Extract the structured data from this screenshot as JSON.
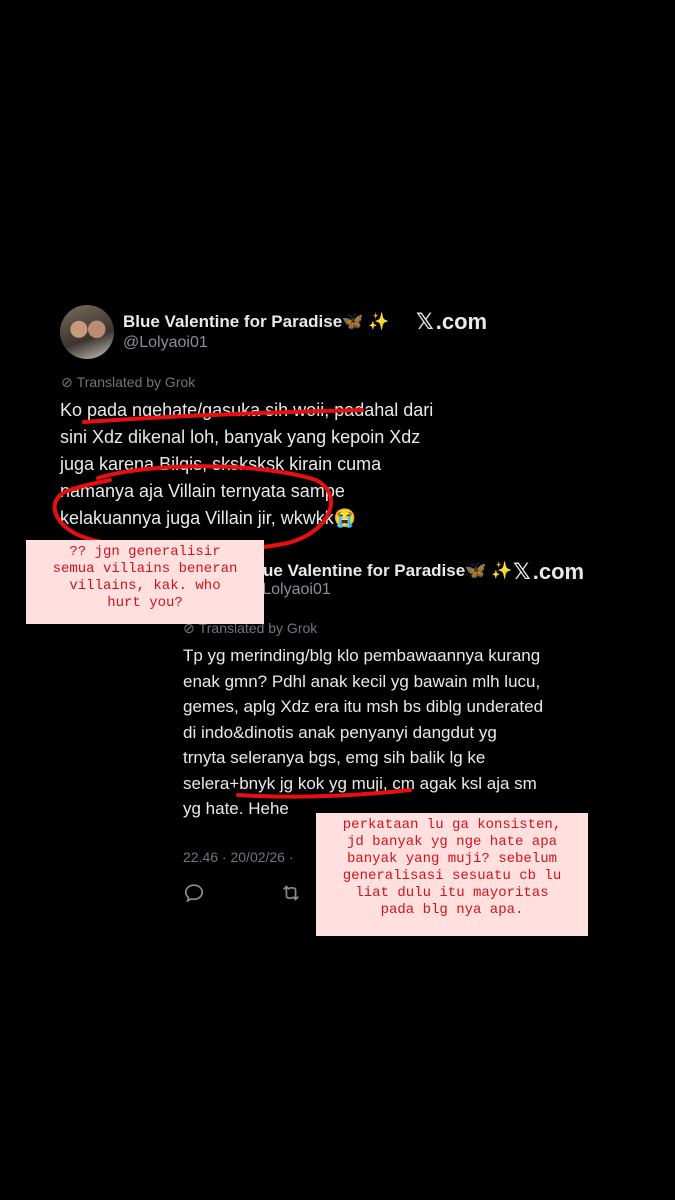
{
  "tweet_main": {
    "display_name": "Blue Valentine for Paradise🦋 ✨",
    "handle": "@Lolyaoi01",
    "site_label": ".com",
    "translated_label": "Translated by Grok",
    "lines": [
      "Ko pada ngehate/gasuka sih woii, padahal dari",
      "sini Xdz dikenal loh, banyak yang kepoin Xdz",
      "juga karena Bilqis, sksksksk kirain cuma",
      "namanya aja Villain ternyata sampe",
      "kelakuannya juga Villain jir, wkwkk😭"
    ]
  },
  "tweet_reply": {
    "display_name": "Blue Valentine for Paradise🦋 ✨",
    "handle": "@Lolyaoi01",
    "site_label": ".com",
    "translated_label": "Translated by Grok",
    "lines": [
      "Tp yg merinding/blg klo pembawaannya kurang",
      "enak gmn? Pdhl anak kecil yg bawain mlh lucu,",
      "gemes, aplg Xdz era itu msh bs diblg underated",
      "di indo&dinotis anak penyanyi dangdut yg",
      "trnyta seleranya bgs, emg sih balik lg ke",
      "selera+bnyk jg kok yg muji, cm agak ksl aja sm",
      "yg hate. Hehe"
    ],
    "timestamp": "22.46 · 20/02/26 ·",
    "reply_icon": "reply-icon",
    "retweet_icon": "retweet-icon"
  },
  "annotations": {
    "note_left": "?? jgn generalisir\nsemua villains beneran\nvillains, kak. who\nhurt you?",
    "note_right": "perkataan lu ga konsisten,\njd banyak yg nge hate apa\nbanyak yang muji? sebelum\ngeneralisasi sesuatu cb lu\nliat dulu itu mayoritas\npada blg nya apa.",
    "ink_color": "#e8100f",
    "note_bg": "#ffe0df"
  }
}
